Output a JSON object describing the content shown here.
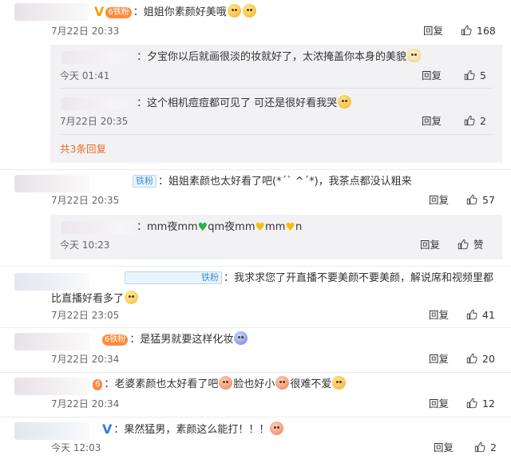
{
  "comments": [
    {
      "text": "姐姐你素颜好美哦",
      "time": "7月22日 20:33",
      "reply": "回复",
      "likes": "168",
      "subreplies": [
        {
          "text": "夕宝你以后就画很淡的妆就好了，太浓掩盖你本身的美貌",
          "time": "今天 01:41",
          "reply": "回复",
          "likes": "5"
        },
        {
          "text": "这个相机痘痘都可见了 可还是很好看我哭",
          "time": "7月22日 20:35",
          "reply": "回复",
          "likes": "2"
        }
      ],
      "more": "共3条回复"
    },
    {
      "badge": "铁粉",
      "text": "姐姐素颜也太好看了吧(*ˊˋ ^ˊ*)，我茶点都没认粗来",
      "time": "7月22日 20:35",
      "reply": "回复",
      "likes": "57",
      "subreplies": [
        {
          "text_a": "mm夜mm",
          "text_b": "qm夜mm",
          "text_c": "mm",
          "text_d": "n",
          "time": "今天 10:23",
          "reply": "回复",
          "likes": "赞"
        }
      ]
    },
    {
      "badge": "铁粉",
      "text": "我求求您了开直播不要美颜不要美颜，解说席和视频里都比直播好看多了",
      "time": "7月22日 23:05",
      "reply": "回复",
      "likes": "41"
    },
    {
      "text": "是猛男就要这样化妆",
      "time": "7月22日 20:34",
      "reply": "回复",
      "likes": "20"
    },
    {
      "text_a": "老婆素颜也太好看了吧",
      "text_b": "脸也好小",
      "text_c": "很难不爱",
      "time": "7月22日 20:34",
      "reply": "回复",
      "likes": "12"
    },
    {
      "text": "果然猛男，素颜这么能打！！！",
      "time": "今天 12:03",
      "reply": "回复",
      "likes": "2"
    }
  ],
  "icons": {
    "verified": "V",
    "fan_badge": "铁粉",
    "fan_level": "6",
    "thumb": "thumbs-up-icon"
  },
  "colors": {
    "accent_orange": "#e86b1e",
    "verified_gold": "#f0a100",
    "verified_blue": "#2d7fe0",
    "fan_badge_blue": "#3d8fd2",
    "subreply_bg": "#f2f2f5"
  }
}
